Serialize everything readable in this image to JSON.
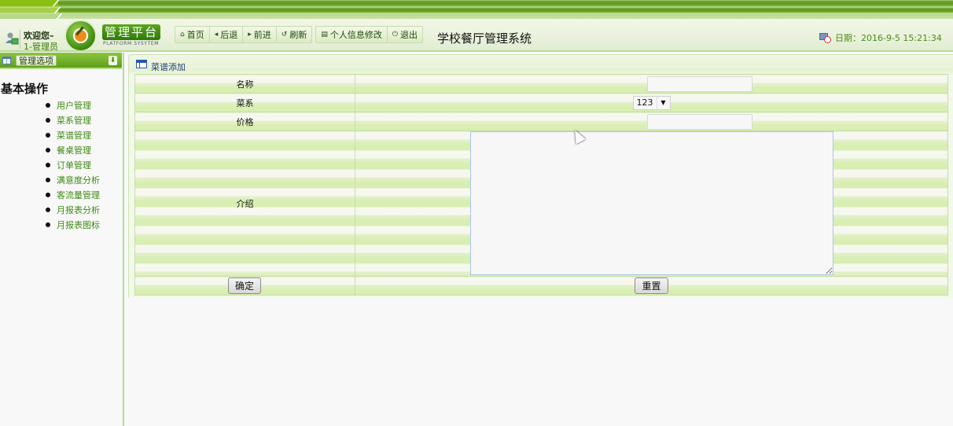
{
  "header": {
    "welcome": "欢迎您–",
    "user": "1-管理员",
    "logo_title": "管理平台",
    "logo_subtitle": "PLATFORM SYSYTEM",
    "system_title": "学校餐厅管理系统",
    "date_label": "日期：2016-9-5 15:21:34",
    "nav": [
      {
        "label": "首页",
        "icon": "home-icon",
        "glyph": "⌂"
      },
      {
        "label": "后退",
        "icon": "back-icon",
        "glyph": "◂"
      },
      {
        "label": "前进",
        "icon": "forward-icon",
        "glyph": "▸"
      },
      {
        "label": "刷新",
        "icon": "refresh-icon",
        "glyph": "↺"
      },
      {
        "label": "个人信息修改",
        "icon": "profile-edit-icon",
        "glyph": "▤"
      },
      {
        "label": "退出",
        "icon": "power-icon",
        "glyph": "⏻"
      }
    ]
  },
  "sidebar": {
    "title": "管理选项",
    "toggle_glyph": "⬇",
    "section": "基本操作",
    "items": [
      {
        "label": "用户管理"
      },
      {
        "label": "菜系管理"
      },
      {
        "label": "菜谱管理"
      },
      {
        "label": "餐桌管理"
      },
      {
        "label": "订单管理"
      },
      {
        "label": "满意度分析"
      },
      {
        "label": "客流量管理"
      },
      {
        "label": "月报表分析"
      },
      {
        "label": "月报表图标"
      }
    ]
  },
  "panel": {
    "title": "菜谱添加",
    "fields": {
      "name_label": "名称",
      "name_value": "",
      "cuisine_label": "菜系",
      "cuisine_value": "123",
      "price_label": "价格",
      "price_value": "",
      "intro_label": "介绍",
      "intro_value": ""
    },
    "confirm_label": "确定",
    "reset_label": "重置"
  },
  "colors": {
    "brand_green": "#5e9e1c",
    "link_green": "#3e8a12",
    "date_green": "#4c8a16"
  }
}
